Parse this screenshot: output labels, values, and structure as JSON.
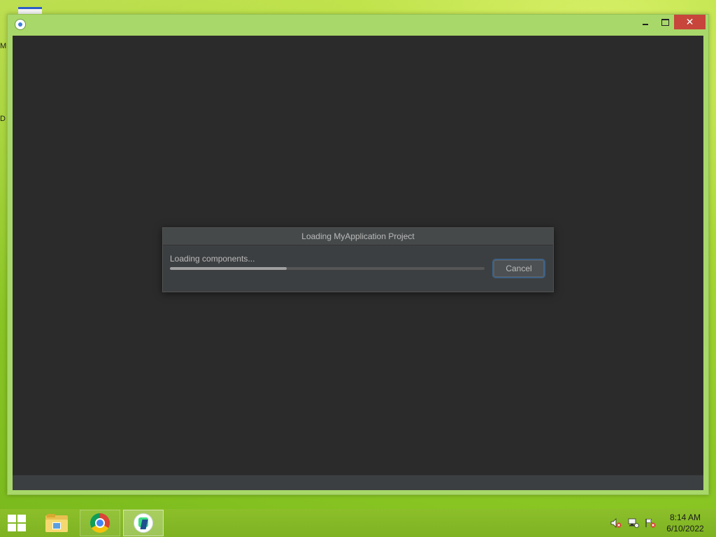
{
  "window": {
    "title": "",
    "controls": {
      "minimize": "minimize",
      "maximize": "maximize",
      "close": "✕"
    }
  },
  "desktop": {
    "icon_fragments": [
      "M",
      "D"
    ]
  },
  "dialog": {
    "title": "Loading MyApplication Project",
    "status": "Loading components...",
    "progress_fraction": 0.37,
    "cancel_label": "Cancel"
  },
  "taskbar": {
    "apps": [
      {
        "name": "file-explorer-icon"
      },
      {
        "name": "chrome-icon"
      },
      {
        "name": "android-studio-icon"
      }
    ],
    "tray": {
      "icons": [
        "volume-muted-icon",
        "network-icon",
        "action-center-flag-icon"
      ]
    },
    "clock": {
      "time": "8:14 AM",
      "date": "6/10/2022"
    }
  },
  "colors": {
    "accent_green": "#a9d86a",
    "close_red": "#c7453a",
    "ide_background": "#2b2b2b",
    "dialog_background": "#3c3f41",
    "focus_blue": "#3d6185"
  }
}
